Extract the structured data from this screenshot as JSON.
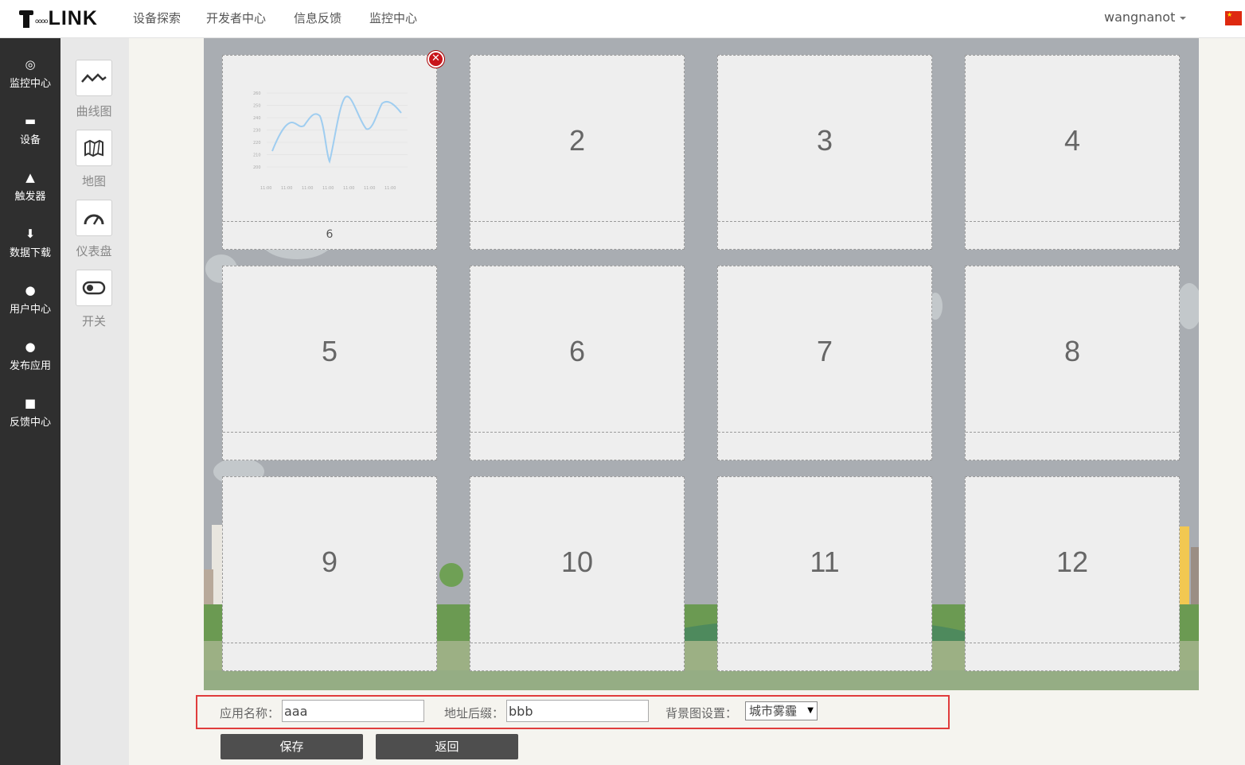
{
  "header": {
    "logo_text": "LINK",
    "logo_dots": "oooo",
    "nav": [
      "设备探索",
      "开发者中心",
      "信息反馈",
      "监控中心"
    ],
    "user": "wangnanot",
    "flag": "cn-flag"
  },
  "sidebar": {
    "items": [
      {
        "label": "监控中心",
        "icon": "◎"
      },
      {
        "label": "设备",
        "icon": "▬"
      },
      {
        "label": "触发器",
        "icon": "▲"
      },
      {
        "label": "数据下载",
        "icon": "⬇"
      },
      {
        "label": "用户中心",
        "icon": "●"
      },
      {
        "label": "发布应用",
        "icon": "●"
      },
      {
        "label": "反馈中心",
        "icon": "■"
      }
    ]
  },
  "widgets": [
    {
      "label": "曲线图",
      "icon": "line-chart-icon"
    },
    {
      "label": "地图",
      "icon": "map-icon"
    },
    {
      "label": "仪表盘",
      "icon": "gauge-icon"
    },
    {
      "label": "开关",
      "icon": "switch-icon"
    }
  ],
  "tiles": [
    {
      "num": "",
      "foot": "6",
      "has_chart": true
    },
    {
      "num": "2",
      "foot": ""
    },
    {
      "num": "3",
      "foot": ""
    },
    {
      "num": "4",
      "foot": ""
    },
    {
      "num": "5",
      "foot": ""
    },
    {
      "num": "6",
      "foot": ""
    },
    {
      "num": "7",
      "foot": ""
    },
    {
      "num": "8",
      "foot": ""
    },
    {
      "num": "9",
      "foot": ""
    },
    {
      "num": "10",
      "foot": ""
    },
    {
      "num": "11",
      "foot": ""
    },
    {
      "num": "12",
      "foot": ""
    }
  ],
  "mini_chart": {
    "y_ticks": [
      "260",
      "250",
      "240",
      "230",
      "220",
      "210",
      "200"
    ],
    "x_ticks": [
      "11:00",
      "11:00",
      "11:00",
      "11:00",
      "11:00",
      "11:00",
      "11:00"
    ]
  },
  "form": {
    "app_name_label": "应用名称：",
    "app_name_value": "aaa",
    "suffix_label": "地址后缀：",
    "suffix_value": "bbb",
    "bg_label": "背景图设置：",
    "bg_value": "城市雾霾"
  },
  "buttons": {
    "save": "保存",
    "back": "返回"
  },
  "colors": {
    "sidebar": "#2f2f2f",
    "canvas": "#a9adb2",
    "accent_red": "#e03c3c",
    "button": "#4e4e4e"
  }
}
